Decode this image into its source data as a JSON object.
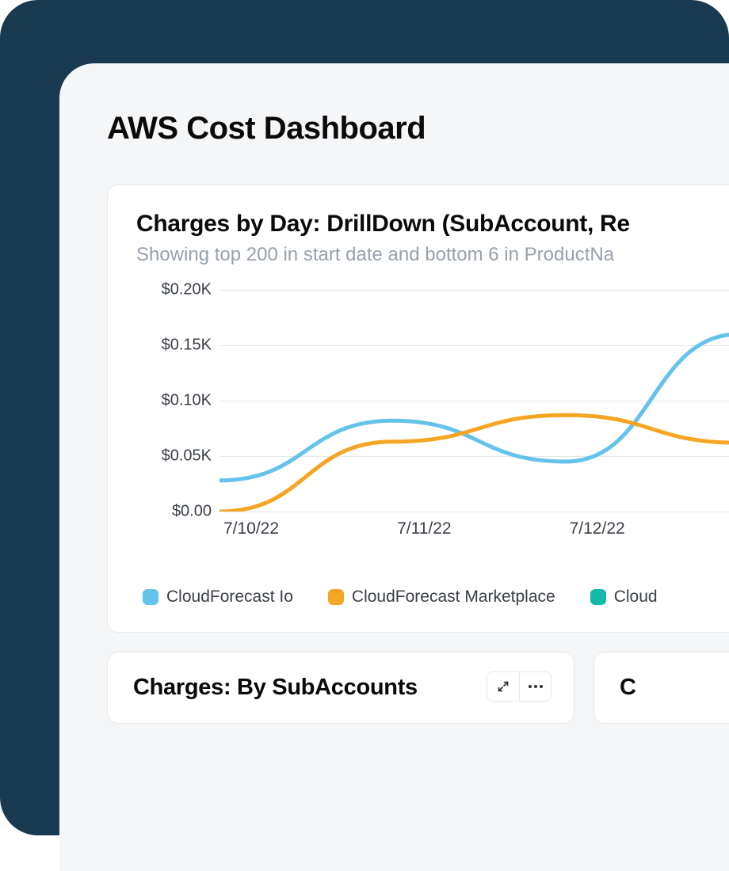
{
  "page": {
    "title": "AWS Cost Dashboard"
  },
  "main_card": {
    "title": "Charges by Day: DrillDown (SubAccount, Re",
    "subtitle": "Showing top 200 in start date and bottom 6 in ProductNa"
  },
  "chart_data": {
    "type": "line",
    "title": "Charges by Day: DrillDown (SubAccount, Re",
    "xlabel": "",
    "ylabel": "",
    "ylim": [
      0,
      0.2
    ],
    "y_ticks": [
      "$0.00",
      "$0.05K",
      "$0.10K",
      "$0.15K",
      "$0.20K"
    ],
    "categories": [
      "7/10/22",
      "7/11/22",
      "7/12/22"
    ],
    "series": [
      {
        "name": "CloudForecast Io",
        "color": "#63c3ea",
        "values": [
          0.028,
          0.082,
          0.045,
          0.16
        ]
      },
      {
        "name": "CloudForecast Marketplace",
        "color": "#f5a524",
        "values": [
          0.0,
          0.063,
          0.087,
          0.062
        ]
      },
      {
        "name": "Cloud",
        "color": "#14b8a6",
        "values": []
      }
    ],
    "grid": true,
    "legend_position": "bottom"
  },
  "bottom_cards": [
    {
      "title": "Charges: By SubAccounts"
    },
    {
      "title": "C"
    }
  ],
  "actions": {
    "expand": "Expand",
    "more": "More"
  },
  "colors": {
    "bg_dark": "#1a3a52",
    "bg_light": "#f5f6f8",
    "text": "#0a0a0a",
    "muted": "#97a0ab",
    "grid": "#e6e8eb"
  }
}
